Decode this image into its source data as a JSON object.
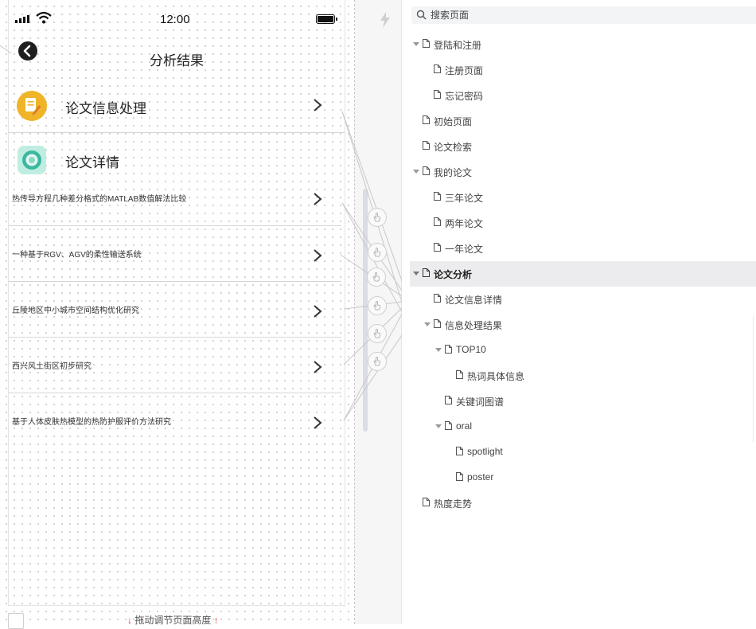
{
  "status_bar": {
    "time": "12:00"
  },
  "page_header": {
    "title": "分析结果"
  },
  "sections": [
    {
      "label": "论文信息处理",
      "icon": "document-pencil-icon"
    },
    {
      "label": "论文详情",
      "icon": "circle-badge-icon"
    }
  ],
  "papers": [
    "热传导方程几种差分格式的MATLAB数值解法比较",
    "一种基于RGV、AGV的柔性输送系统",
    "丘陵地区中小城市空间结构优化研究",
    "西兴风土街区初步研究",
    "基于人体皮肤热模型的热防护服评价方法研究"
  ],
  "resize_bar": {
    "label": "拖动调节页面高度"
  },
  "search": {
    "placeholder": "搜索页面",
    "value": ""
  },
  "tree": [
    {
      "label": "登陆和注册",
      "level": 0,
      "expanded": true
    },
    {
      "label": "注册页面",
      "level": 1
    },
    {
      "label": "忘记密码",
      "level": 1
    },
    {
      "label": "初始页面",
      "level": 0
    },
    {
      "label": "论文检索",
      "level": 0
    },
    {
      "label": "我的论文",
      "level": 0,
      "expanded": true
    },
    {
      "label": "三年论文",
      "level": 1
    },
    {
      "label": "两年论文",
      "level": 1
    },
    {
      "label": "一年论文",
      "level": 1
    },
    {
      "label": "论文分析",
      "level": 0,
      "expanded": true,
      "selected": true
    },
    {
      "label": "论文信息详情",
      "level": 1
    },
    {
      "label": "信息处理结果",
      "level": 1,
      "expanded": true
    },
    {
      "label": "TOP10",
      "level": 2,
      "expanded": true
    },
    {
      "label": "热词具体信息",
      "level": 3
    },
    {
      "label": "关键词图谱",
      "level": 2
    },
    {
      "label": "oral",
      "level": 2,
      "expanded": true
    },
    {
      "label": "spotlight",
      "level": 3
    },
    {
      "label": "poster",
      "level": 3
    },
    {
      "label": "热度走势",
      "level": 0
    }
  ],
  "colors": {
    "accent_red": "#e5352b",
    "selected_bg": "#ececee",
    "scroll_thumb": "#dadde6"
  }
}
